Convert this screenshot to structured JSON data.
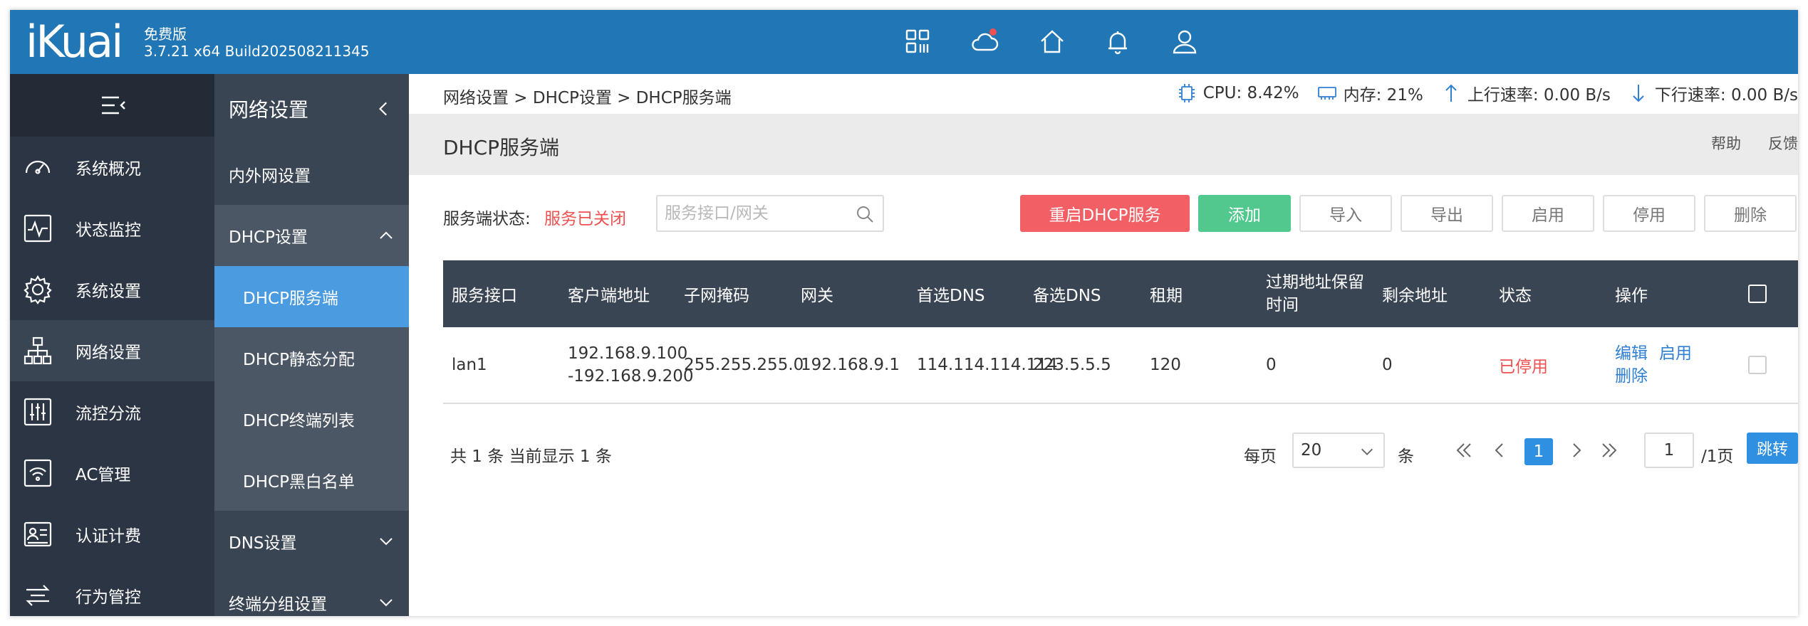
{
  "header": {
    "logo": "iKuai",
    "edition": "免费版",
    "build": "3.7.21 x64 Build202508211345",
    "icons": [
      "apps-icon",
      "cloud-icon",
      "home-icon",
      "bell-icon",
      "user-icon"
    ],
    "brand_color": "#2176b5",
    "notification_dot_color": "#f05050"
  },
  "sidebar": {
    "items": [
      {
        "label": "系统概况",
        "icon": "dashboard-icon"
      },
      {
        "label": "状态监控",
        "icon": "monitor-icon"
      },
      {
        "label": "系统设置",
        "icon": "gear-icon"
      },
      {
        "label": "网络设置",
        "icon": "network-icon"
      },
      {
        "label": "流控分流",
        "icon": "sliders-icon"
      },
      {
        "label": "AC管理",
        "icon": "wifi-icon"
      },
      {
        "label": "认证计费",
        "icon": "id-card-icon"
      },
      {
        "label": "行为管控",
        "icon": "exchange-icon"
      }
    ]
  },
  "submenu": {
    "title": "网络设置",
    "items": [
      "内外网设置",
      "DHCP设置",
      "DNS设置",
      "终端分组设置"
    ],
    "children": [
      "DHCP服务端",
      "DHCP静态分配",
      "DHCP终端列表",
      "DHCP黑白名单"
    ]
  },
  "topbar": {
    "breadcrumb": "网络设置 > DHCP设置 > DHCP服务端",
    "cpu": "CPU: 8.42%",
    "memory": "内存: 21%",
    "upload": "上行速率: 0.00 B/s",
    "download": "下行速率: 0.00 B/s"
  },
  "page": {
    "title": "DHCP服务端",
    "help": "帮助",
    "feedback": "反馈"
  },
  "toolbar": {
    "status_label": "服务端状态:",
    "status_value": "服务已关闭",
    "search_placeholder": "服务接口/网关",
    "restart": "重启DHCP服务",
    "add": "添加",
    "import": "导入",
    "export": "导出",
    "enable": "启用",
    "disable": "停用",
    "delete": "删除"
  },
  "table": {
    "headers": [
      "服务接口",
      "客户端地址",
      "子网掩码",
      "网关",
      "首选DNS",
      "备选DNS",
      "租期",
      "过期地址保留时间",
      "剩余地址",
      "状态",
      "操作"
    ],
    "rows": [
      {
        "iface": "lan1",
        "range_start": "192.168.9.100",
        "range_end": "-192.168.9.200",
        "mask": "255.255.255.0",
        "gateway": "192.168.9.1",
        "dns1": "114.114.114.114",
        "dns2": "223.5.5.5",
        "lease": "120",
        "expire_keep": "0",
        "remaining": "0",
        "status": "已停用",
        "op_edit": "编辑",
        "op_enable": "启用",
        "op_delete": "删除"
      }
    ]
  },
  "pager": {
    "summary": "共 1 条 当前显示 1 条",
    "per_page_label": "每页",
    "per_page": "20",
    "per_page_unit": "条",
    "current": "1",
    "jump_value": "1",
    "total_pages": "/1页",
    "jump": "跳转"
  }
}
